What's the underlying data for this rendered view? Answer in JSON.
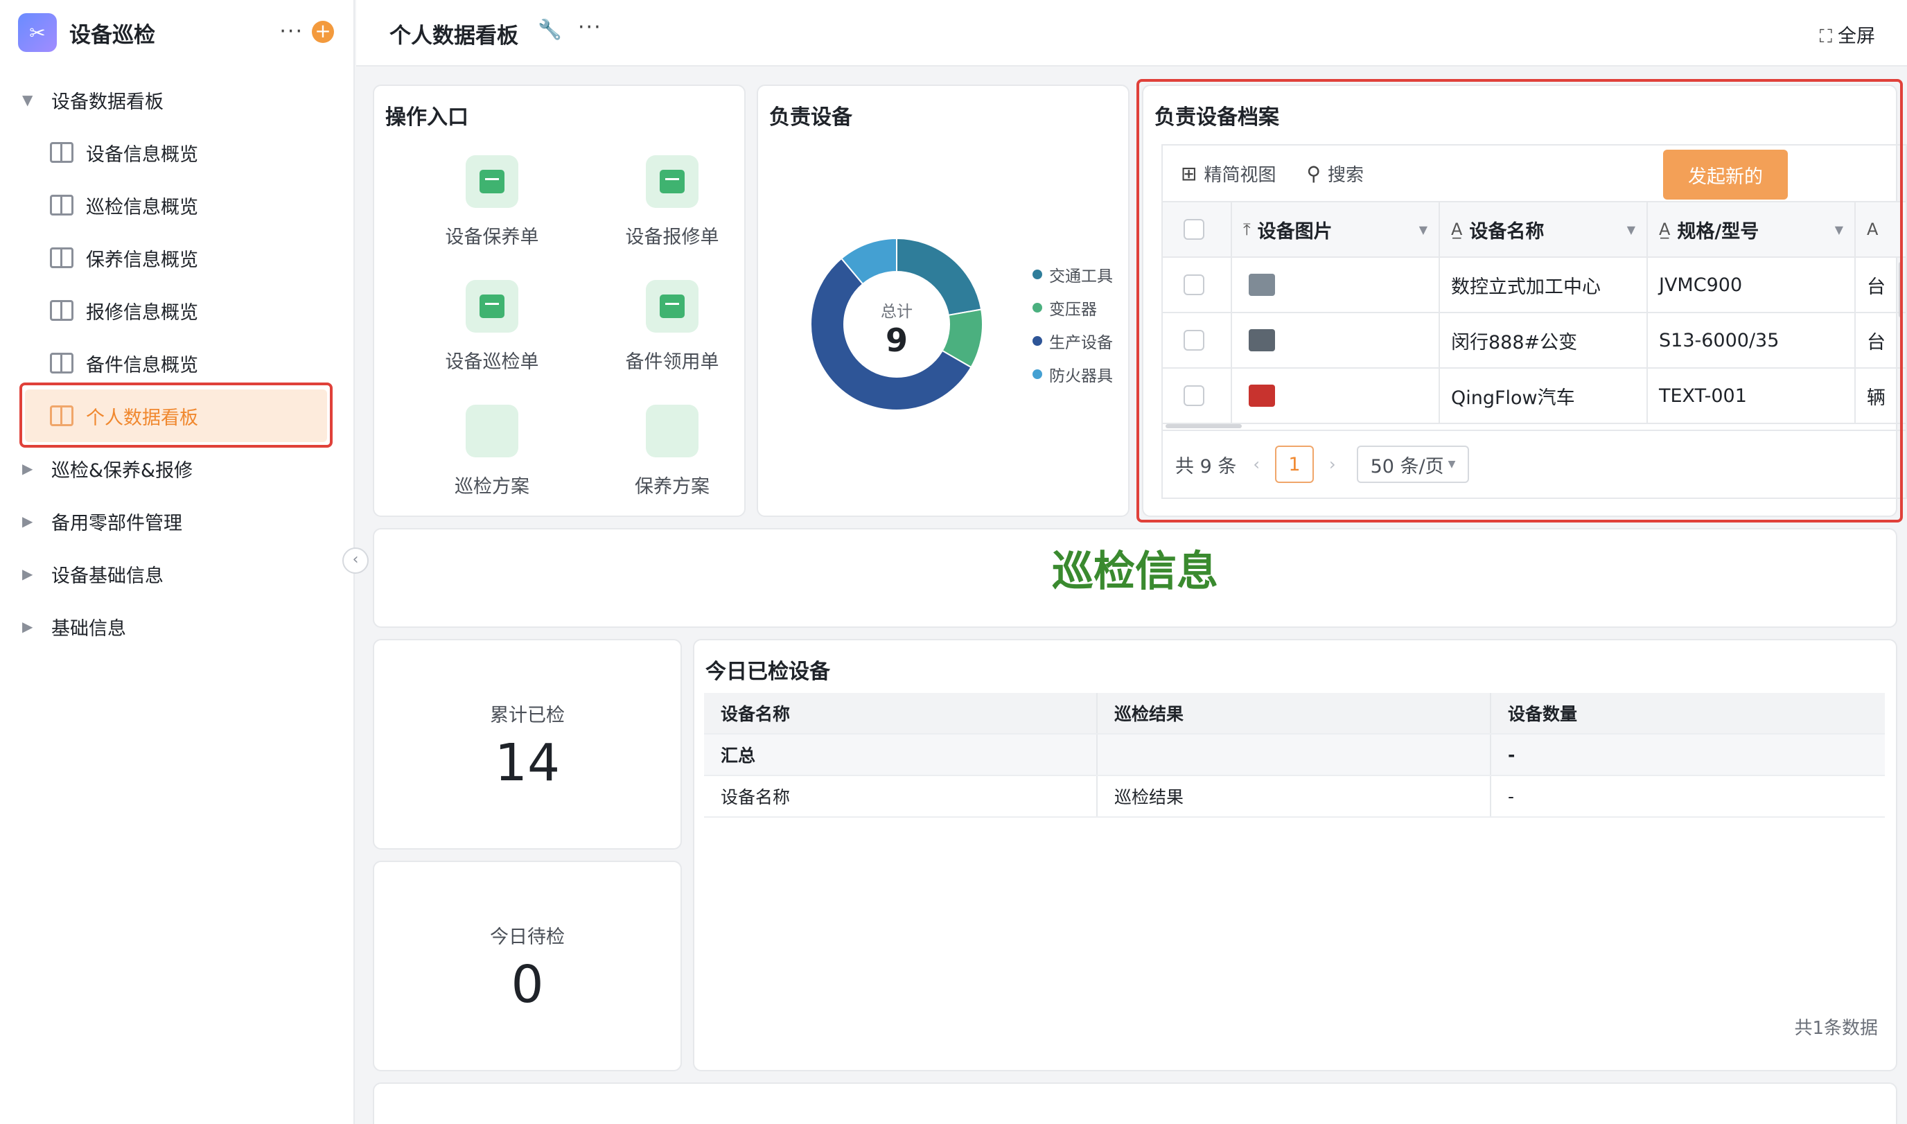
{
  "sidebar": {
    "app_title": "设备巡检",
    "items": [
      {
        "label": "设备数据看板",
        "type": "group",
        "expanded": true
      },
      {
        "label": "设备信息概览",
        "type": "sub"
      },
      {
        "label": "巡检信息概览",
        "type": "sub"
      },
      {
        "label": "保养信息概览",
        "type": "sub"
      },
      {
        "label": "报修信息概览",
        "type": "sub"
      },
      {
        "label": "备件信息概览",
        "type": "sub"
      },
      {
        "label": "个人数据看板",
        "type": "sub",
        "active": true
      },
      {
        "label": "巡检&保养&报修",
        "type": "group"
      },
      {
        "label": "备用零部件管理",
        "type": "group"
      },
      {
        "label": "设备基础信息",
        "type": "group"
      },
      {
        "label": "基础信息",
        "type": "group"
      }
    ]
  },
  "topbar": {
    "title": "个人数据看板",
    "fullscreen": "全屏"
  },
  "ops": {
    "title": "操作入口",
    "entries": [
      "设备保养单",
      "设备报修单",
      "设备巡检单",
      "备件领用单",
      "巡检方案",
      "保养方案"
    ]
  },
  "equipment": {
    "title": "负责设备",
    "total_label": "总计",
    "total": "9",
    "legend": [
      {
        "name": "交通工具",
        "color": "#2f7d9a"
      },
      {
        "name": "变压器",
        "color": "#4bb07f"
      },
      {
        "name": "生产设备",
        "color": "#2e5597"
      },
      {
        "name": "防火器具",
        "color": "#44a0d2"
      }
    ],
    "slices": [
      {
        "name": "交通工具",
        "value": 2,
        "color": "#2f7d9a"
      },
      {
        "name": "变压器",
        "value": 1,
        "color": "#4bb07f"
      },
      {
        "name": "生产设备",
        "value": 5,
        "color": "#2e5597"
      },
      {
        "name": "防火器具",
        "value": 1,
        "color": "#44a0d2"
      }
    ]
  },
  "archive": {
    "title": "负责设备档案",
    "view_label": "精简视图",
    "search_label": "搜索",
    "new_label": "发起新的",
    "columns": [
      "设备图片",
      "设备名称",
      "规格/型号"
    ],
    "last_col_partial": "A",
    "rows": [
      {
        "name": "数控立式加工中心",
        "model": "JVMC900",
        "unit": "台",
        "thumb_color": "#7f8b96"
      },
      {
        "name": "闵行888#公变",
        "model": "S13-6000/35",
        "unit": "台",
        "thumb_color": "#5c6670"
      },
      {
        "name": "QingFlow汽车",
        "model": "TEXT-001",
        "unit": "辆",
        "thumb_color": "#c8332e"
      }
    ],
    "total_text": "共 9 条",
    "page": "1",
    "per_page": "50 条/页"
  },
  "patrol": {
    "title": "巡检信息",
    "cumulative_label": "累计已检",
    "cumulative_value": "14",
    "today_pending_label": "今日待检",
    "today_pending_value": "0",
    "today_title": "今日已检设备",
    "table": {
      "headers": [
        "设备名称",
        "巡检结果",
        "设备数量"
      ],
      "summary": [
        "汇总",
        "",
        "-"
      ],
      "rows": [
        [
          "设备名称",
          "巡检结果",
          "-"
        ]
      ]
    },
    "footer": "共1条数据"
  }
}
